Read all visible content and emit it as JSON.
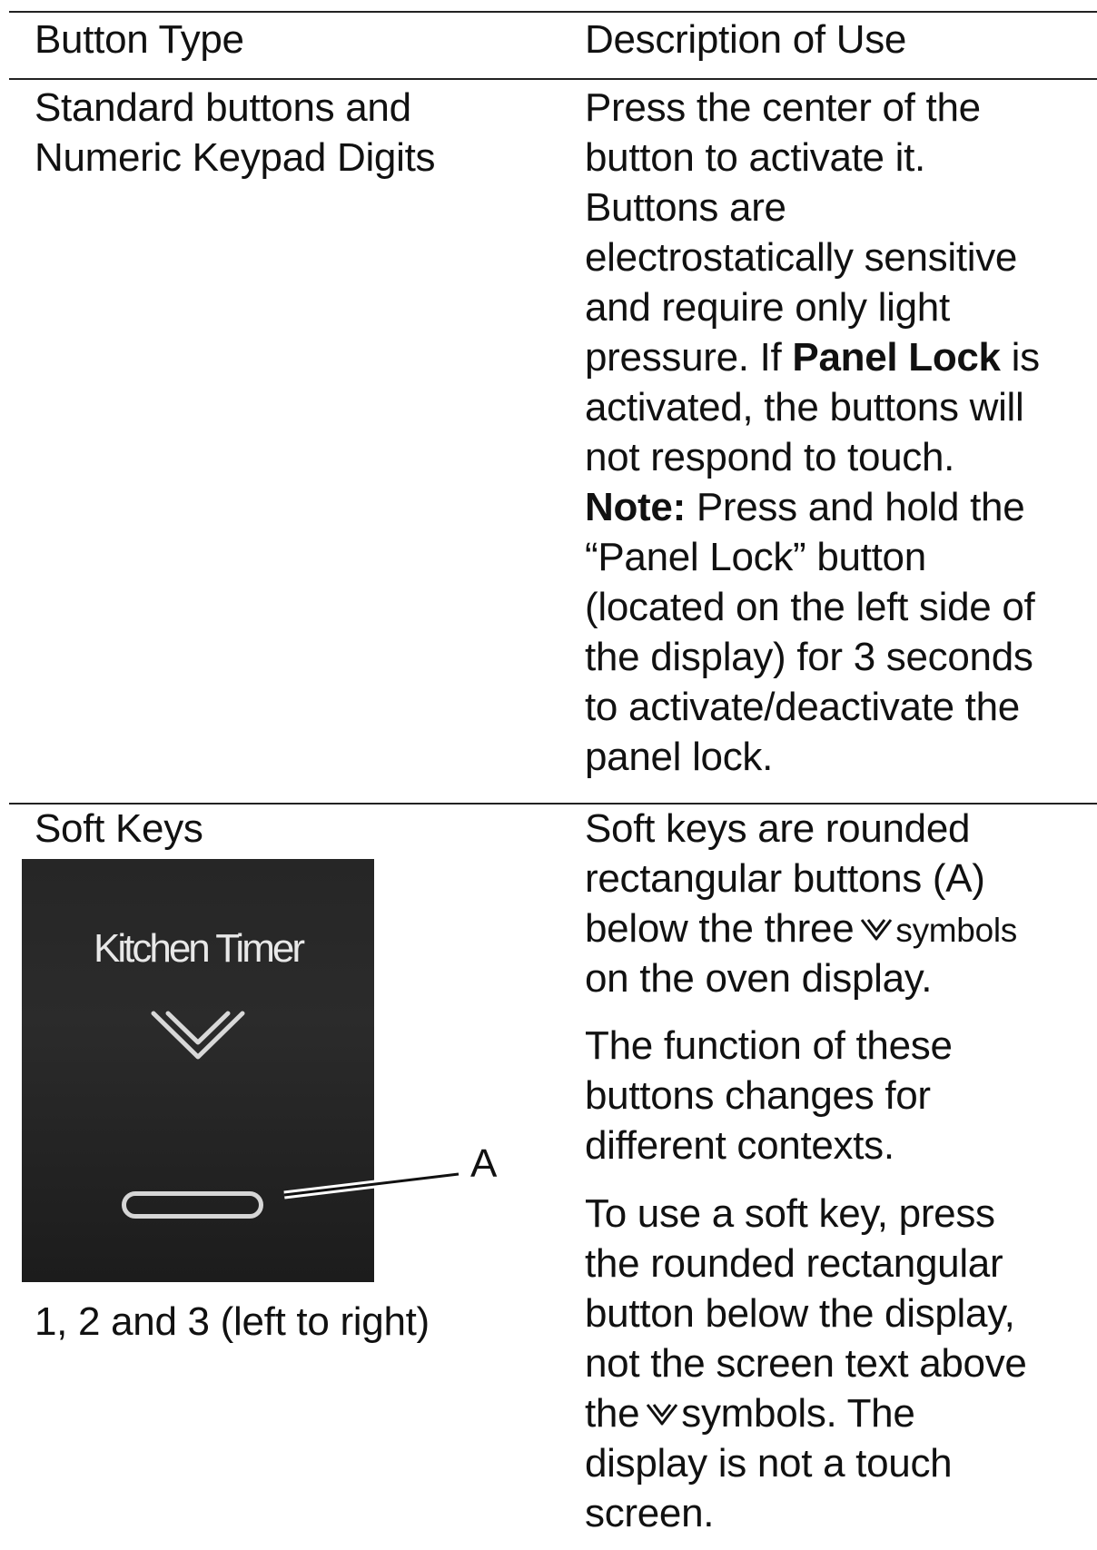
{
  "table": {
    "header": {
      "col1": "Button Type",
      "col2": "Description of Use"
    },
    "row1": {
      "type_lines": [
        "Standard buttons and",
        "Numeric Keypad Digits"
      ],
      "desc": {
        "l1": "Press the center of the",
        "l2": "button to activate it.",
        "l3": "Buttons are",
        "l4": "electrostatically sensitive",
        "l5": "and require only light",
        "l6_pre": "pressure. If ",
        "l6_bold": "Panel Lock",
        "l6_post": " is",
        "l7": "activated, the buttons will",
        "l8": "not respond to touch.",
        "l9_bold": "Note:",
        "l9_post": " Press and hold the",
        "l10": "“Panel Lock” button",
        "l11": "(located on the left side of",
        "l12": "the display) for 3 seconds",
        "l13": "to activate/deactivate the",
        "l14": "panel lock."
      }
    },
    "row2": {
      "type_label": "Soft Keys",
      "image": {
        "screen_text": "Kitchen Timer",
        "callout_label": "A"
      },
      "caption": "1, 2 and 3 (left to right)",
      "desc": {
        "p1_l1": "Soft keys are rounded",
        "p1_l2": "rectangular buttons (A)",
        "p1_l3_pre": "below the three",
        "p1_l3_post": "symbols",
        "p1_l4": "on the oven display.",
        "p2_l1": "The function of these",
        "p2_l2": "buttons changes for",
        "p2_l3": "different contexts.",
        "p3_l1": "To use a soft key, press",
        "p3_l2": "the rounded rectangular",
        "p3_l3": "button below the display,",
        "p3_l4": "not the screen text above",
        "p3_l5_pre": "the",
        "p3_l5_post": "symbols. The",
        "p3_l6": "display is not a touch",
        "p3_l7": "screen."
      }
    }
  },
  "icons": {
    "chevron": "double-chevron-down-icon"
  },
  "colors": {
    "display_bg": "#262626",
    "display_text": "#e8e8e8",
    "rule": "#222222"
  }
}
